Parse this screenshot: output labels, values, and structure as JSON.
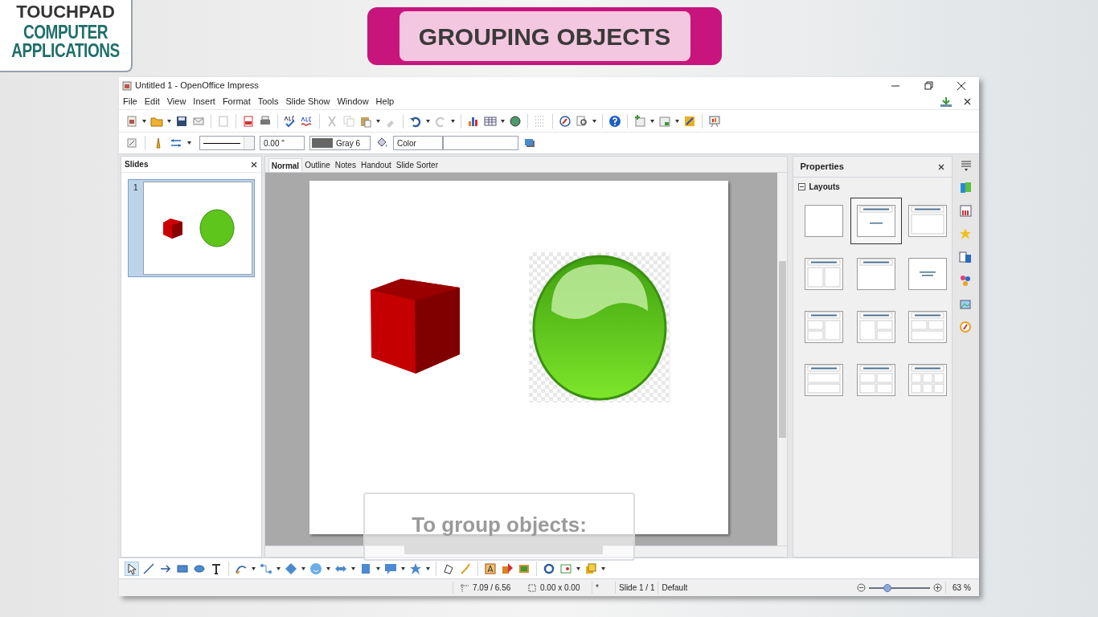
{
  "logo": {
    "brand": "TOUCHPAD",
    "line1": "COMPUTER",
    "line2": "APPLICATIONS"
  },
  "banner": {
    "title": "GROUPING OBJECTS"
  },
  "window": {
    "title": "Untitled 1 - OpenOffice Impress"
  },
  "menu": [
    "File",
    "Edit",
    "View",
    "Insert",
    "Format",
    "Tools",
    "Slide Show",
    "Window",
    "Help"
  ],
  "line_toolbar": {
    "line_width": "0.00 \"",
    "line_color": "Gray 6",
    "area_style": "Color"
  },
  "slides_panel": {
    "title": "Slides",
    "slides": [
      {
        "number": "1",
        "selected": true
      }
    ]
  },
  "view_tabs": [
    {
      "label": "Normal",
      "selected": true
    },
    {
      "label": "Outline",
      "selected": false
    },
    {
      "label": "Notes",
      "selected": false
    },
    {
      "label": "Handout",
      "selected": false
    },
    {
      "label": "Slide Sorter",
      "selected": false
    }
  ],
  "properties": {
    "title": "Properties",
    "section": {
      "title": "Layouts",
      "expanded": true,
      "layouts": [
        {
          "kind": "blank",
          "selected": false
        },
        {
          "kind": "title-slide",
          "selected": true
        },
        {
          "kind": "title-content",
          "selected": false
        },
        {
          "kind": "title-two-content",
          "selected": false
        },
        {
          "kind": "title-only",
          "selected": false
        },
        {
          "kind": "centered-text",
          "selected": false
        },
        {
          "kind": "title-two-content-and-content",
          "selected": false
        },
        {
          "kind": "title-content-and-two-content",
          "selected": false
        },
        {
          "kind": "title-two-content-over-content",
          "selected": false
        },
        {
          "kind": "title-content-over-content",
          "selected": false
        },
        {
          "kind": "title-four-content",
          "selected": false
        },
        {
          "kind": "title-six-content",
          "selected": false
        }
      ]
    }
  },
  "caption": {
    "text": "To group objects:"
  },
  "status_bar": {
    "position": "7.09 / 6.56",
    "size": "0.00 x 0.00",
    "modified": "*",
    "slide": "Slide 1 / 1",
    "master": "Default",
    "zoom": {
      "level": 0.3
    },
    "zoom_percent": "63 %"
  }
}
